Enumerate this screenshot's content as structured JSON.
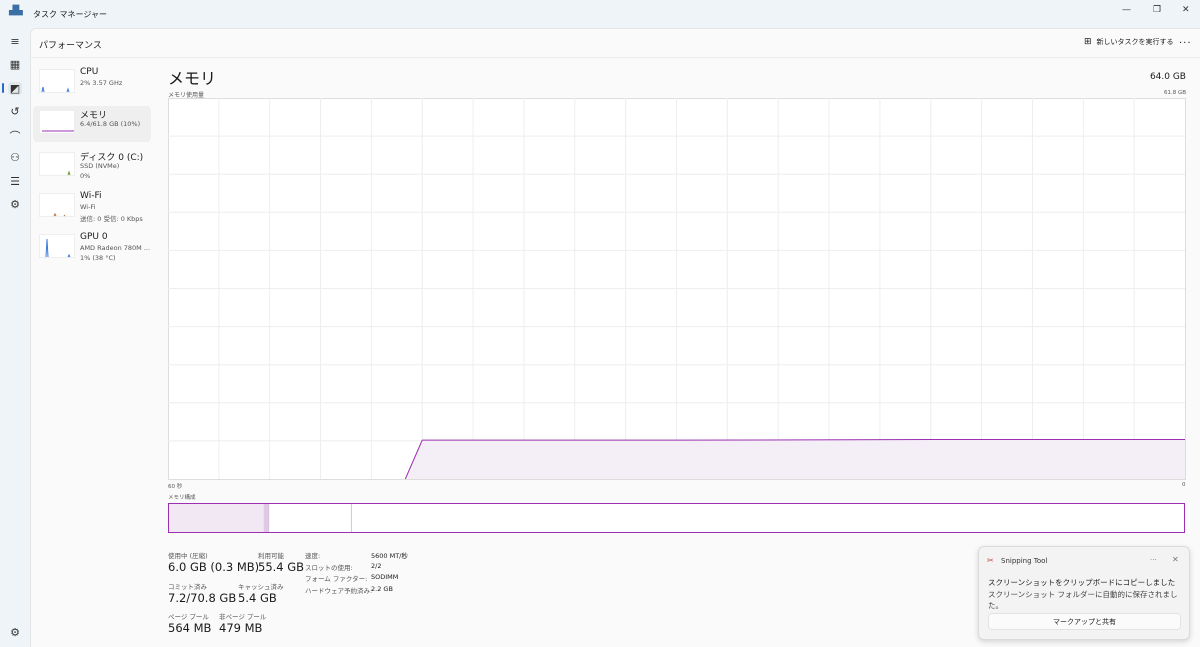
{
  "window": {
    "title": "タスク マネージャー",
    "app_icon": "task-manager-icon"
  },
  "header": {
    "title": "パフォーマンス",
    "new_task": "新しいタスクを実行する",
    "more": "..."
  },
  "rail": [
    "hamburger-icon",
    "processes-icon",
    "performance-icon",
    "app-history-icon",
    "startup-icon",
    "users-icon",
    "details-icon",
    "services-icon",
    "settings-icon"
  ],
  "sidebar": [
    {
      "name": "CPU",
      "sub1": "2% 3.57 GHz",
      "sub2": ""
    },
    {
      "name": "メモリ",
      "sub1": "6.4/61.8 GB (10%)",
      "sub2": "",
      "selected": true
    },
    {
      "name": "ディスク 0 (C:)",
      "sub1": "SSD (NVMe)",
      "sub2": "0%"
    },
    {
      "name": "Wi-Fi",
      "sub1": "Wi-Fi",
      "sub2": "送信: 0 受信: 0 Kbps"
    },
    {
      "name": "GPU 0",
      "sub1": "AMD Radeon 780M ...",
      "sub2": "1% (38 °C)"
    }
  ],
  "main": {
    "title": "メモリ",
    "total": "64.0 GB",
    "usage_label": "メモリ使用量",
    "usage_max": "61.8 GB",
    "time_left": "60 秒",
    "time_right": "0",
    "composition_label": "メモリ構成",
    "accent": "#9b30b0"
  },
  "chart_data": {
    "type": "area",
    "xlim": [
      60,
      0
    ],
    "ylim": [
      0,
      61.8
    ],
    "grid": true,
    "x": [
      60,
      46,
      45,
      30,
      15,
      0
    ],
    "y": [
      null,
      0,
      6.3,
      6.3,
      6.4,
      6.4
    ]
  },
  "composition": {
    "in_use_gb": 6.0,
    "modified_gb": 0.3,
    "standby_gb": 5.4,
    "total_gb": 61.8
  },
  "stats": [
    {
      "label": "使用中 (圧縮)",
      "value": "6.0 GB (0.3 MB)"
    },
    {
      "label": "利用可能",
      "value": "55.4 GB"
    },
    {
      "label": "コミット済み",
      "value": "7.2/70.8 GB"
    },
    {
      "label": "キャッシュ済み",
      "value": "5.4 GB"
    },
    {
      "label": "ページ プール",
      "value": "564 MB"
    },
    {
      "label": "非ページ プール",
      "value": "479 MB"
    }
  ],
  "specs": [
    {
      "k": "速度:",
      "v": "5600 MT/秒"
    },
    {
      "k": "スロットの使用:",
      "v": "2/2"
    },
    {
      "k": "フォーム ファクター:",
      "v": "SODIMM"
    },
    {
      "k": "ハードウェア予約済み:",
      "v": "2.2 GB"
    }
  ],
  "toast": {
    "app": "Snipping Tool",
    "line1": "スクリーンショットをクリップボードにコピーしました",
    "line2": "スクリーンショット フォルダーに自動的に保存されました。",
    "button": "マークアップと共有",
    "more": "···",
    "close": "✕"
  }
}
